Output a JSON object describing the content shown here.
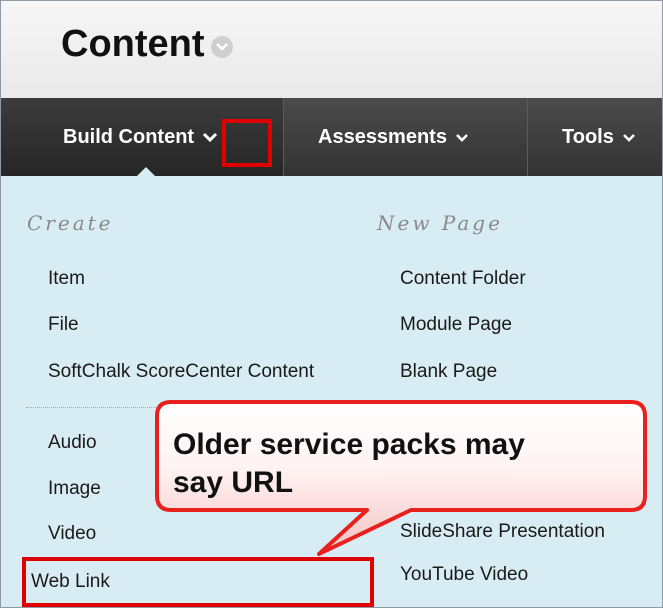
{
  "page": {
    "title": "Content"
  },
  "nav": {
    "tabs": [
      {
        "label": "Build Content"
      },
      {
        "label": "Assessments"
      },
      {
        "label": "Tools"
      }
    ]
  },
  "menu": {
    "create": {
      "heading": "Create",
      "items": [
        "Item",
        "File",
        "SoftChalk ScoreCenter Content",
        "Audio",
        "Image",
        "Video",
        "Web Link"
      ]
    },
    "new_page": {
      "heading": "New Page",
      "items": [
        "Content Folder",
        "Module Page",
        "Blank Page",
        "SlideShare Presentation",
        "YouTube Video"
      ]
    }
  },
  "callout": {
    "line1": "Older service packs may",
    "line2": "say URL"
  },
  "colors": {
    "navbar": "#3a3a3a",
    "menu_bg": "#d8ecf3",
    "highlight_red": "#e00000",
    "callout_red": "#e8201e"
  }
}
